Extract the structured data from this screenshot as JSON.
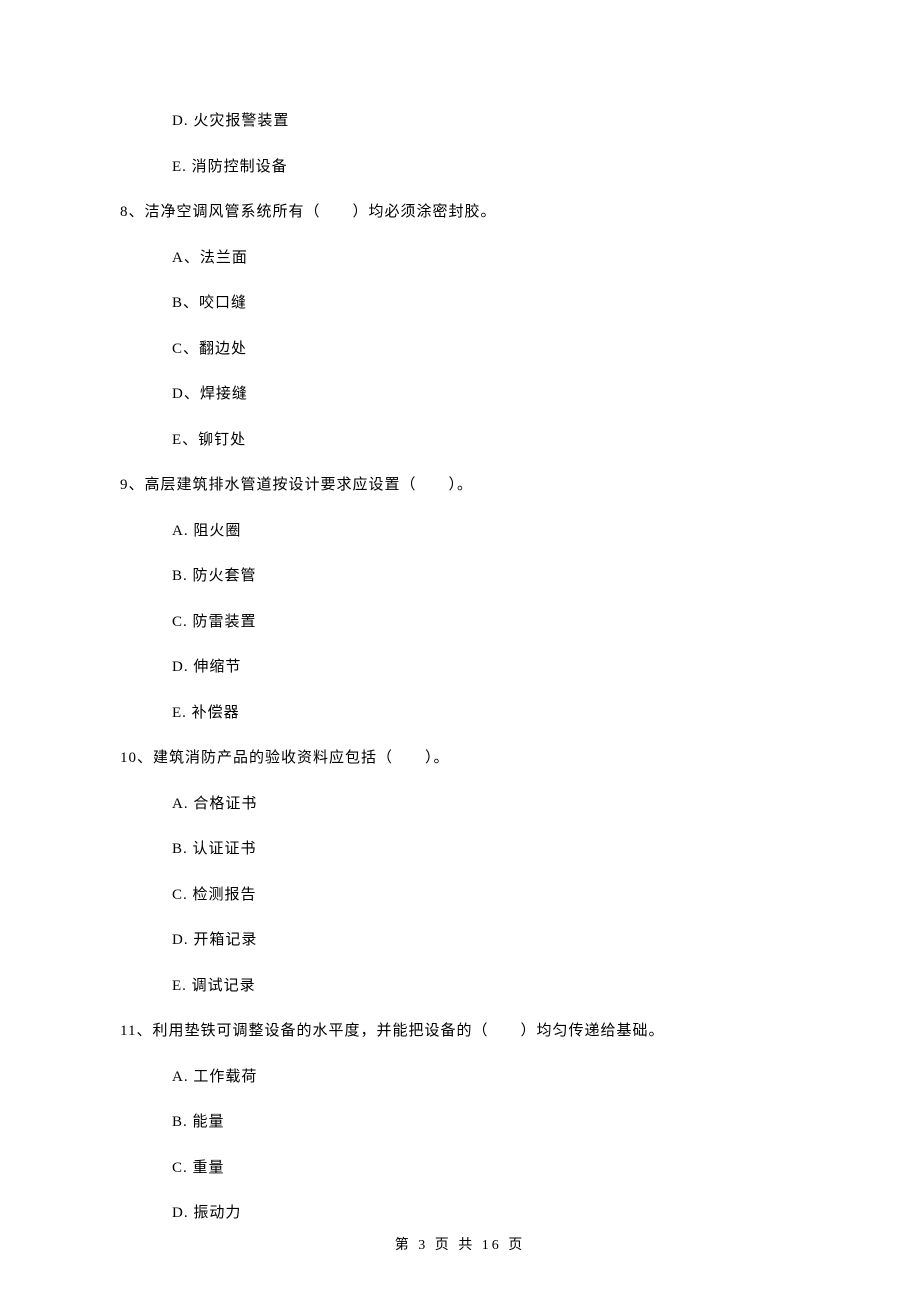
{
  "lead_options": [
    "D. 火灾报警装置",
    "E. 消防控制设备"
  ],
  "questions": [
    {
      "number": "8、",
      "text": "洁净空调风管系统所有（　　）均必须涂密封胶。",
      "options": [
        "A、法兰面",
        "B、咬口缝",
        "C、翻边处",
        "D、焊接缝",
        "E、铆钉处"
      ]
    },
    {
      "number": "9、",
      "text": "高层建筑排水管道按设计要求应设置（　　）。",
      "options": [
        "A. 阻火圈",
        "B. 防火套管",
        "C. 防雷装置",
        "D. 伸缩节",
        "E. 补偿器"
      ]
    },
    {
      "number": "10、",
      "text": "建筑消防产品的验收资料应包括（　　）。",
      "options": [
        "A. 合格证书",
        "B. 认证证书",
        "C. 检测报告",
        "D. 开箱记录",
        "E. 调试记录"
      ]
    },
    {
      "number": "11、",
      "text": "利用垫铁可调整设备的水平度，并能把设备的（　　）均匀传递给基础。",
      "options": [
        "A. 工作载荷",
        "B. 能量",
        "C. 重量",
        "D. 振动力"
      ]
    }
  ],
  "footer": "第 3 页 共 16 页"
}
